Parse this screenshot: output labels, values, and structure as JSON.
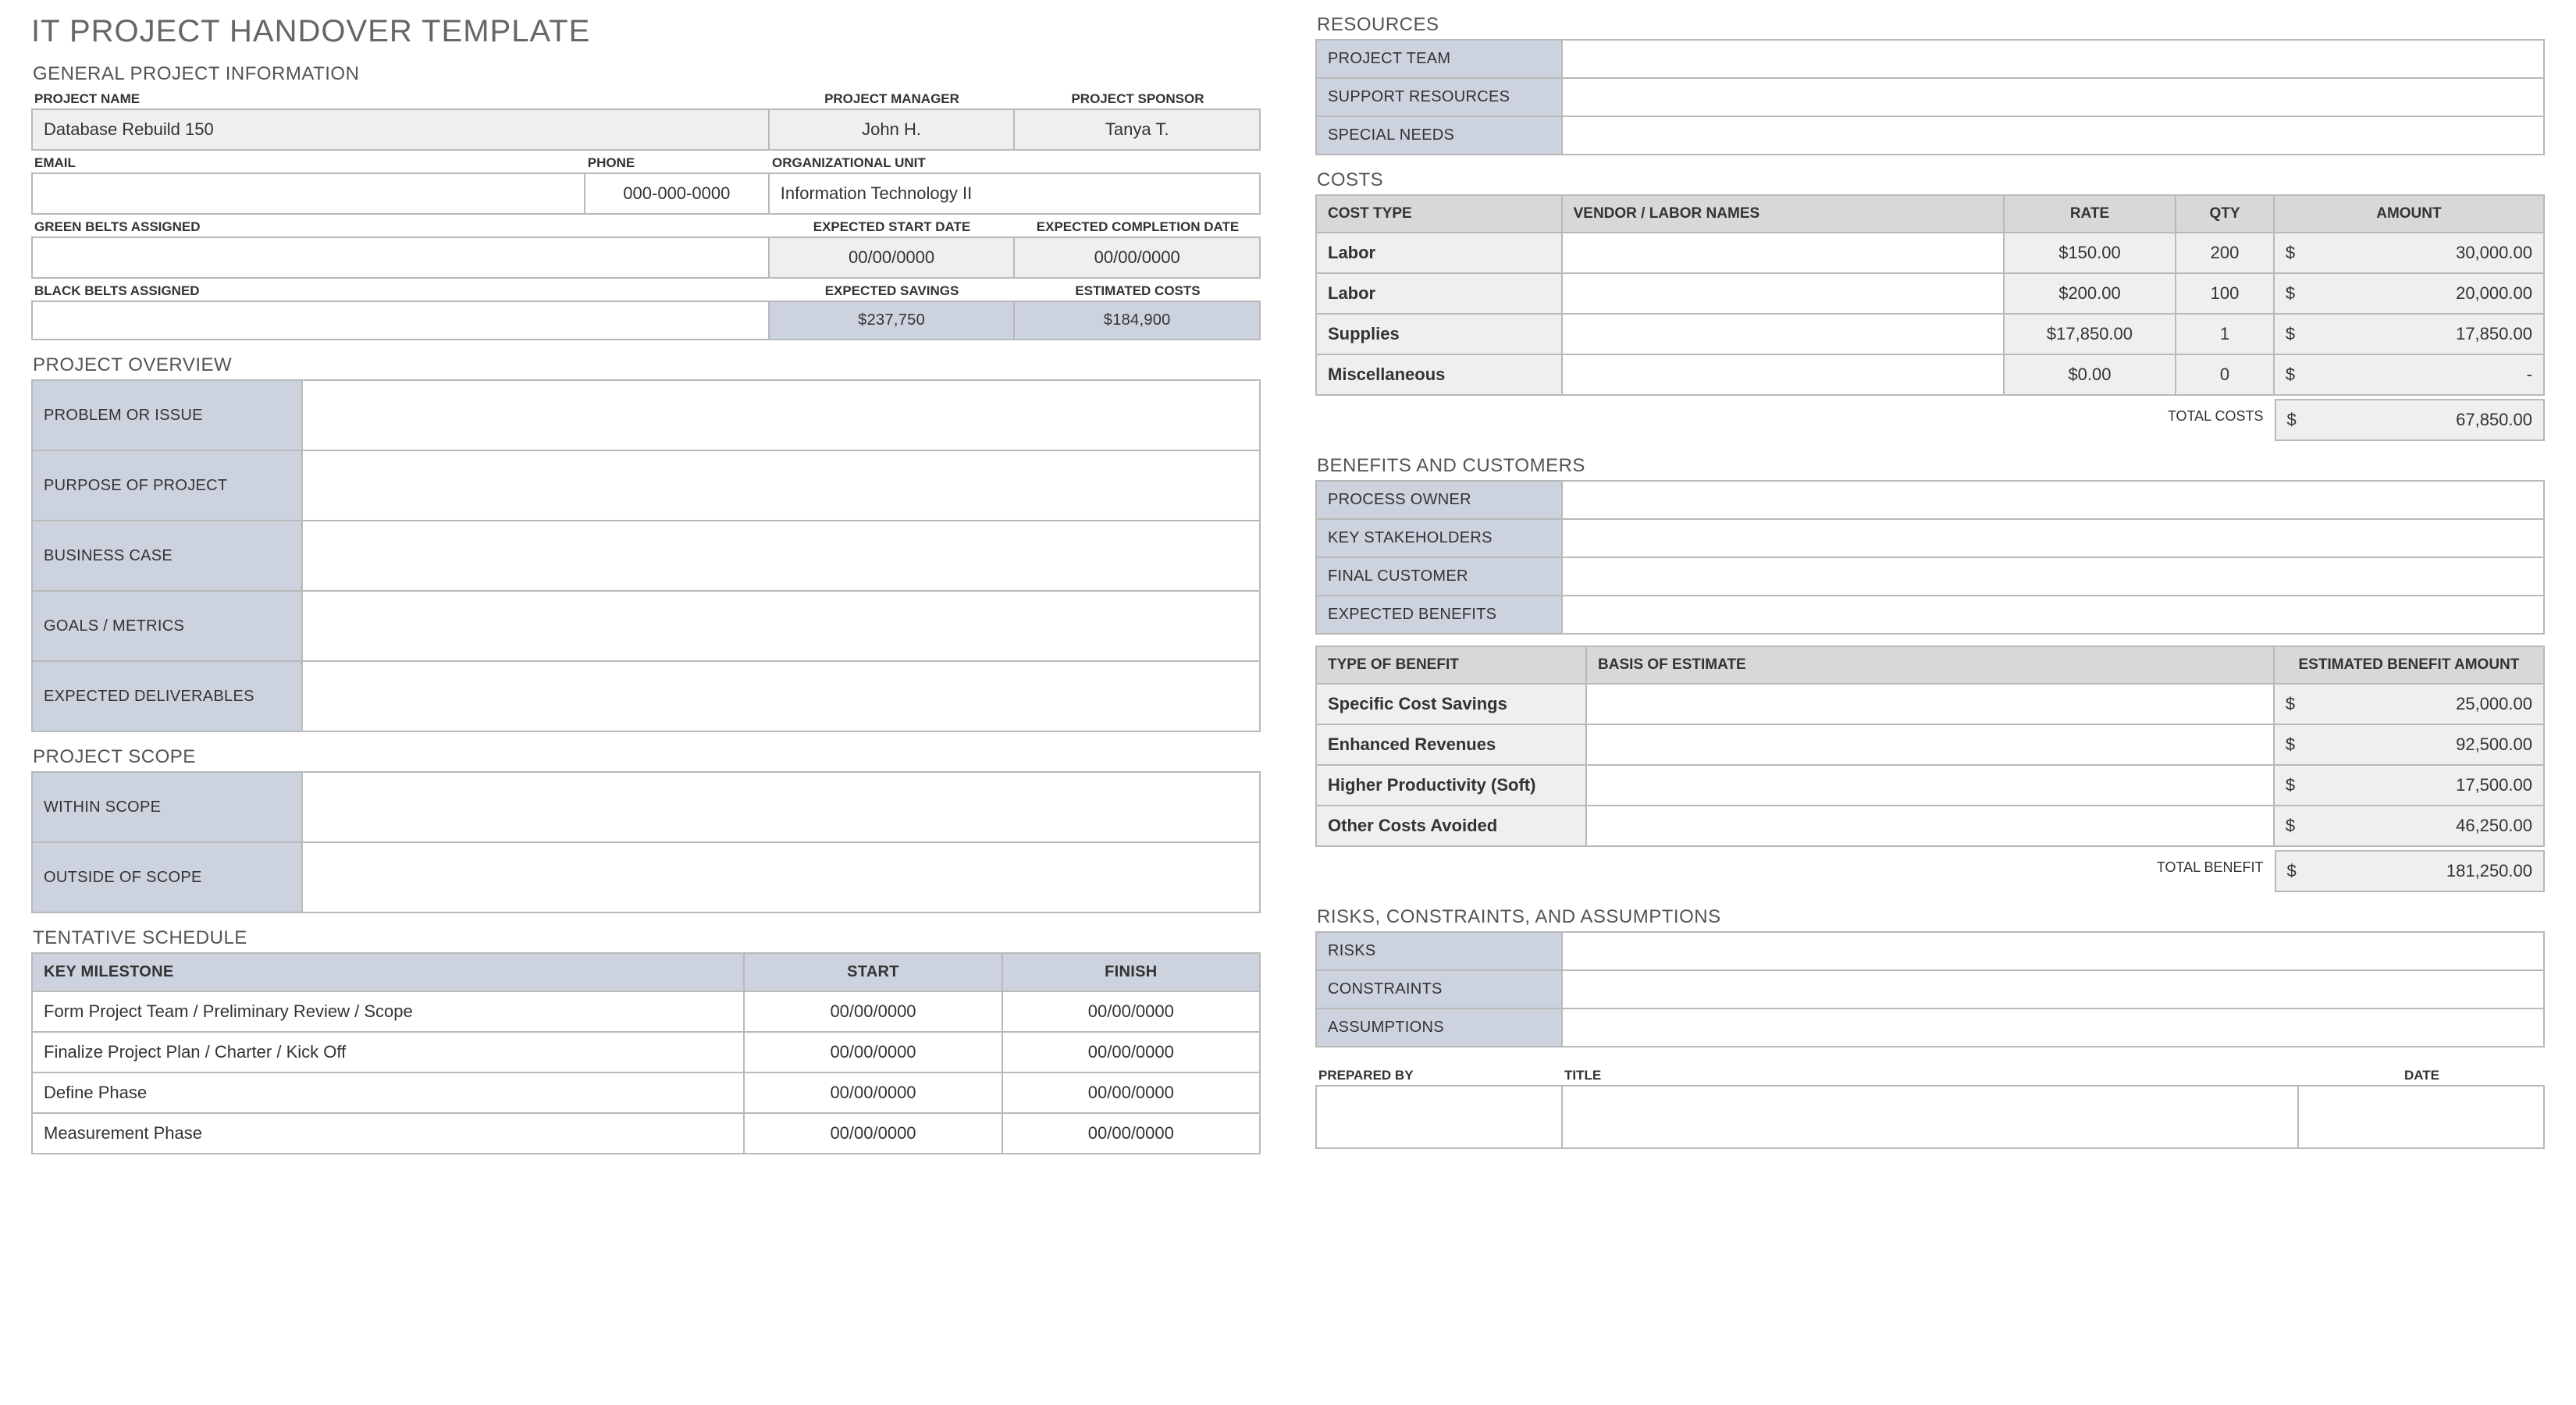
{
  "title": "IT PROJECT HANDOVER TEMPLATE",
  "general": {
    "heading": "GENERAL PROJECT INFORMATION",
    "labels": {
      "project_name": "PROJECT NAME",
      "project_manager": "PROJECT MANAGER",
      "project_sponsor": "PROJECT SPONSOR",
      "email": "EMAIL",
      "phone": "PHONE",
      "org_unit": "ORGANIZATIONAL UNIT",
      "green_belts": "GREEN BELTS ASSIGNED",
      "expected_start": "EXPECTED START DATE",
      "expected_completion": "EXPECTED COMPLETION DATE",
      "black_belts": "BLACK BELTS ASSIGNED",
      "expected_savings": "EXPECTED SAVINGS",
      "estimated_costs": "ESTIMATED COSTS"
    },
    "values": {
      "project_name": "Database Rebuild 150",
      "project_manager": "John H.",
      "project_sponsor": "Tanya T.",
      "email": "",
      "phone": "000-000-0000",
      "org_unit": "Information Technology II",
      "green_belts": "",
      "expected_start": "00/00/0000",
      "expected_completion": "00/00/0000",
      "black_belts": "",
      "expected_savings": "$237,750",
      "estimated_costs": "$184,900"
    }
  },
  "overview": {
    "heading": "PROJECT OVERVIEW",
    "rows": {
      "problem": "PROBLEM OR ISSUE",
      "purpose": "PURPOSE OF PROJECT",
      "business_case": "BUSINESS CASE",
      "goals": "GOALS / METRICS",
      "deliverables": "EXPECTED DELIVERABLES"
    }
  },
  "scope": {
    "heading": "PROJECT SCOPE",
    "rows": {
      "within": "WITHIN SCOPE",
      "outside": "OUTSIDE OF SCOPE"
    }
  },
  "schedule": {
    "heading": "TENTATIVE SCHEDULE",
    "headers": {
      "milestone": "KEY MILESTONE",
      "start": "START",
      "finish": "FINISH"
    },
    "rows": [
      {
        "name": "Form Project Team / Preliminary Review / Scope",
        "start": "00/00/0000",
        "finish": "00/00/0000"
      },
      {
        "name": "Finalize Project Plan / Charter / Kick Off",
        "start": "00/00/0000",
        "finish": "00/00/0000"
      },
      {
        "name": "Define Phase",
        "start": "00/00/0000",
        "finish": "00/00/0000"
      },
      {
        "name": "Measurement Phase",
        "start": "00/00/0000",
        "finish": "00/00/0000"
      }
    ]
  },
  "resources": {
    "heading": "RESOURCES",
    "rows": {
      "team": "PROJECT TEAM",
      "support": "SUPPORT RESOURCES",
      "special": "SPECIAL NEEDS"
    }
  },
  "costs": {
    "heading": "COSTS",
    "headers": {
      "type": "COST TYPE",
      "vendor": "VENDOR / LABOR NAMES",
      "rate": "RATE",
      "qty": "QTY",
      "amount": "AMOUNT"
    },
    "rows": [
      {
        "type": "Labor",
        "vendor": "",
        "rate": "$150.00",
        "qty": "200",
        "amount": "30,000.00"
      },
      {
        "type": "Labor",
        "vendor": "",
        "rate": "$200.00",
        "qty": "100",
        "amount": "20,000.00"
      },
      {
        "type": "Supplies",
        "vendor": "",
        "rate": "$17,850.00",
        "qty": "1",
        "amount": "17,850.00"
      },
      {
        "type": "Miscellaneous",
        "vendor": "",
        "rate": "$0.00",
        "qty": "0",
        "amount": "-"
      }
    ],
    "total_label": "TOTAL COSTS",
    "total_value": "67,850.00"
  },
  "benefits": {
    "heading": "BENEFITS AND CUSTOMERS",
    "info_rows": {
      "process_owner": "PROCESS OWNER",
      "stakeholders": "KEY STAKEHOLDERS",
      "customer": "FINAL CUSTOMER",
      "expected": "EXPECTED BENEFITS"
    },
    "headers": {
      "type": "TYPE OF BENEFIT",
      "basis": "BASIS OF ESTIMATE",
      "amount": "ESTIMATED BENEFIT AMOUNT"
    },
    "rows": [
      {
        "type": "Specific Cost Savings",
        "basis": "",
        "amount": "25,000.00"
      },
      {
        "type": "Enhanced Revenues",
        "basis": "",
        "amount": "92,500.00"
      },
      {
        "type": "Higher Productivity (Soft)",
        "basis": "",
        "amount": "17,500.00"
      },
      {
        "type": "Other Costs Avoided",
        "basis": "",
        "amount": "46,250.00"
      }
    ],
    "total_label": "TOTAL BENEFIT",
    "total_value": "181,250.00"
  },
  "risks": {
    "heading": "RISKS, CONSTRAINTS, AND ASSUMPTIONS",
    "rows": {
      "risks": "RISKS",
      "constraints": "CONSTRAINTS",
      "assumptions": "ASSUMPTIONS"
    }
  },
  "signoff": {
    "labels": {
      "prepared_by": "PREPARED BY",
      "title": "TITLE",
      "date": "DATE"
    }
  },
  "currency": "$"
}
